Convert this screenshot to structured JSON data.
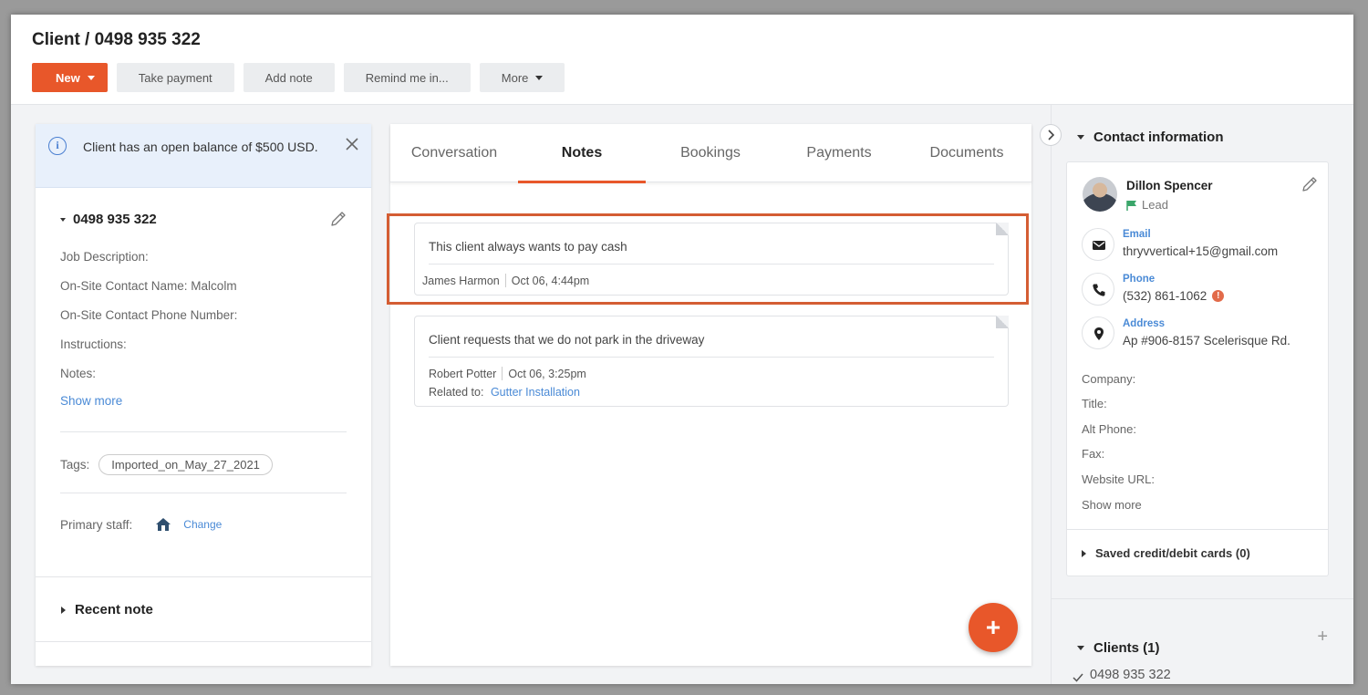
{
  "header": {
    "title": "Client / 0498 935 322",
    "buttons": {
      "new": "New",
      "take_payment": "Take payment",
      "add_note": "Add note",
      "remind": "Remind me in...",
      "more": "More"
    }
  },
  "left": {
    "alert": "Client has an open balance of $500 USD.",
    "section_title": "0498 935 322",
    "fields": {
      "job_description": "Job Description:",
      "contact_name": "On-Site Contact Name: Malcolm",
      "contact_phone": "On-Site Contact Phone Number:",
      "instructions": "Instructions:",
      "notes": "Notes:"
    },
    "show_more": "Show more",
    "tags_label": "Tags:",
    "tag": "Imported_on_May_27_2021",
    "primary_staff_label": "Primary staff:",
    "change_link": "Change",
    "recent_note": "Recent note"
  },
  "tabs": [
    "Conversation",
    "Notes",
    "Bookings",
    "Payments",
    "Documents"
  ],
  "notes": [
    {
      "text": "This client always wants to pay cash",
      "author": "James Harmon",
      "time": "Oct 06, 4:44pm"
    },
    {
      "text": "Client requests that we do not park in the driveway",
      "author": "Robert Potter",
      "time": "Oct 06, 3:25pm",
      "related_label": "Related to:",
      "related_link": "Gutter Installation"
    }
  ],
  "fab_label": "+",
  "right": {
    "contact_title": "Contact information",
    "name": "Dillon Spencer",
    "status": "Lead",
    "email_label": "Email",
    "email": "thryvvertical+15@gmail.com",
    "phone_label": "Phone",
    "phone": "(532) 861-1062",
    "address_label": "Address",
    "address": "Ap #906-8157 Scelerisque Rd.",
    "fields": {
      "company": "Company:",
      "title": "Title:",
      "alt_phone": "Alt Phone:",
      "fax": "Fax:",
      "website": "Website URL:"
    },
    "show_more": "Show more",
    "saved_cards": "Saved credit/debit cards (0)",
    "clients_title": "Clients (1)",
    "client_item": "0498 935 322",
    "plus": "+"
  },
  "colors": {
    "accent": "#e8572a",
    "link": "#4a8ad6",
    "alert_bg": "#e8f0fb",
    "lead_flag": "#3aa66a",
    "warning": "#e26b4a"
  }
}
